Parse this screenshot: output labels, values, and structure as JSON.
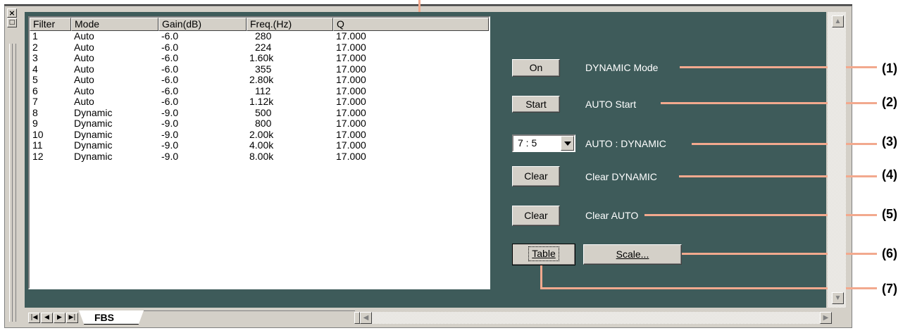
{
  "table": {
    "headers": [
      "Filter",
      "Mode",
      "Gain(dB)",
      "Freq.(Hz)",
      "Q"
    ],
    "rows": [
      [
        "1",
        "Auto",
        "-6.0",
        "280",
        "17.000"
      ],
      [
        "2",
        "Auto",
        "-6.0",
        "224",
        "17.000"
      ],
      [
        "3",
        "Auto",
        "-6.0",
        "1.60k",
        "17.000"
      ],
      [
        "4",
        "Auto",
        "-6.0",
        "355",
        "17.000"
      ],
      [
        "5",
        "Auto",
        "-6.0",
        "2.80k",
        "17.000"
      ],
      [
        "6",
        "Auto",
        "-6.0",
        "112",
        "17.000"
      ],
      [
        "7",
        "Auto",
        "-6.0",
        "1.12k",
        "17.000"
      ],
      [
        "8",
        "Dynamic",
        "-9.0",
        "500",
        "17.000"
      ],
      [
        "9",
        "Dynamic",
        "-9.0",
        "800",
        "17.000"
      ],
      [
        "10",
        "Dynamic",
        "-9.0",
        "2.00k",
        "17.000"
      ],
      [
        "11",
        "Dynamic",
        "-9.0",
        "4.00k",
        "17.000"
      ],
      [
        "12",
        "Dynamic",
        "-9.0",
        "8.00k",
        "17.000"
      ]
    ]
  },
  "controls": {
    "dynamic_mode": {
      "button": "On",
      "label": "DYNAMIC Mode",
      "callout": "(1)"
    },
    "auto_start": {
      "button": "Start",
      "label": "AUTO Start",
      "callout": "(2)"
    },
    "ratio": {
      "value": "7 : 5",
      "label": "AUTO : DYNAMIC",
      "callout": "(3)"
    },
    "clear_dynamic": {
      "button": "Clear",
      "label": "Clear DYNAMIC",
      "callout": "(4)"
    },
    "clear_auto": {
      "button": "Clear",
      "label": "Clear AUTO",
      "callout": "(5)"
    },
    "scale": {
      "button": "Scale...",
      "callout": "(6)"
    },
    "table": {
      "button": "Table",
      "callout": "(7)"
    }
  },
  "toolbar": {
    "close_glyph": "×",
    "restore_glyph": "□"
  },
  "tabs": {
    "active": "FBS"
  },
  "colors": {
    "pane": "#3e5b5a",
    "callout": "#f2a98e",
    "face": "#d4d0c8"
  },
  "icons": [
    "close-icon",
    "restore-icon",
    "first-page-icon",
    "prev-page-icon",
    "next-page-icon",
    "last-page-icon",
    "dropdown-arrow-icon",
    "scroll-up-icon",
    "scroll-down-icon",
    "scroll-left-icon",
    "scroll-right-icon"
  ]
}
